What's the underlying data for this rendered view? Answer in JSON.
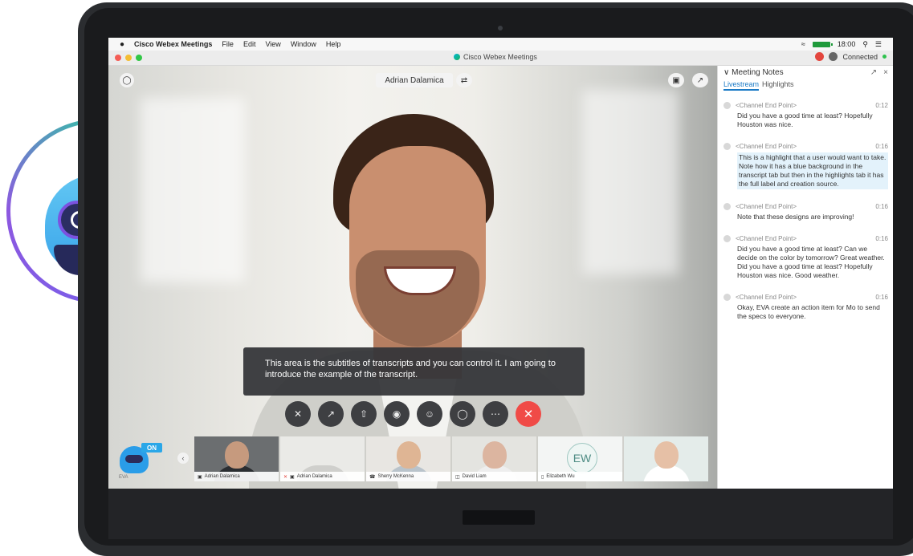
{
  "menubar": {
    "apple": "",
    "app": "Cisco Webex Meetings",
    "items": [
      "File",
      "Edit",
      "View",
      "Window",
      "Help"
    ],
    "time": "18:00"
  },
  "window": {
    "title": "Cisco Webex Meetings",
    "status": "Connected"
  },
  "video": {
    "speaker_name": "Adrian Dalamica"
  },
  "subtitle": {
    "text": "This area is the subtitles of transcripts and you can control it. I am going to introduce the example of the transcript."
  },
  "filmstrip": {
    "bot_badge": "ON",
    "bot_caption": "EVA",
    "tiles": [
      {
        "label": "Adrian Dalamica"
      },
      {
        "label": "Adrian Dalamica"
      },
      {
        "label": "Sherry McKenna"
      },
      {
        "label": "David Liam"
      },
      {
        "label": "Elizabeth Wu",
        "initials": "EW"
      },
      {
        "label": ""
      }
    ]
  },
  "notes": {
    "title": "Meeting Notes",
    "tabs": [
      "Livestream",
      "Highlights"
    ],
    "entries": [
      {
        "speaker": "<Channel End Point>",
        "time": "0:12",
        "text": "Did you have a good time at least? Hopefully Houston was nice."
      },
      {
        "speaker": "<Channel End Point>",
        "time": "0:16",
        "text": "This is a highlight that a user would want to take. Note how it has a blue background in the transcript tab but then in the highlights tab it has the full label and creation source."
      },
      {
        "speaker": "<Channel End Point>",
        "time": "0:16",
        "text": "Note that these designs are improving!"
      },
      {
        "speaker": "<Channel End Point>",
        "time": "0:16",
        "text": "Did you have a good time at least? Can we decide on the color by tomorrow? Great weather. Did you have a good time at least? Hopefully Houston was nice. Good weather."
      },
      {
        "speaker": "<Channel End Point>",
        "time": "0:16",
        "text": "Okay, EVA create an action item for Mo to send the specs to everyone."
      }
    ]
  },
  "colors": {
    "end_call": "#f04b47",
    "accent": "#1a7ac6",
    "highlight_bg": "#e3f2fb"
  }
}
